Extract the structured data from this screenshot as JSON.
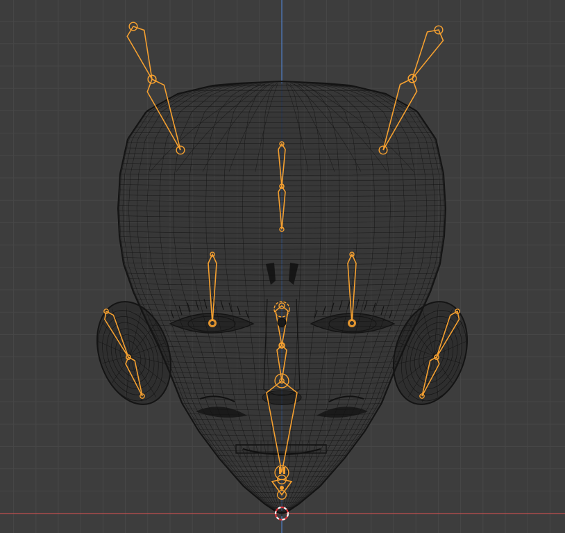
{
  "viewport": {
    "mode": "wireframe",
    "view": "front-orthographic",
    "colors": {
      "background": "#3d3d3d",
      "grid_minor": "#474747",
      "grid_major": "#4f4f4f",
      "axis_x": "#c0504f",
      "axis_z": "#4f7fc8",
      "mesh_wire": "#141414",
      "armature": "#f5a030",
      "cursor_red": "#e0313a",
      "cursor_white": "#ffffff"
    },
    "objects": [
      {
        "name": "Head",
        "type": "mesh",
        "display": "wire"
      },
      {
        "name": "Armature",
        "type": "armature",
        "display": "octahedral",
        "state": "selected"
      }
    ],
    "bones": [
      "ear-tip-left",
      "ear-tip-right",
      "forehead",
      "eye-left",
      "eye-right",
      "ear-left",
      "ear-right",
      "nose",
      "jaw",
      "chin"
    ],
    "icons": [
      "3d-cursor-icon",
      "origin-point-icon"
    ]
  }
}
